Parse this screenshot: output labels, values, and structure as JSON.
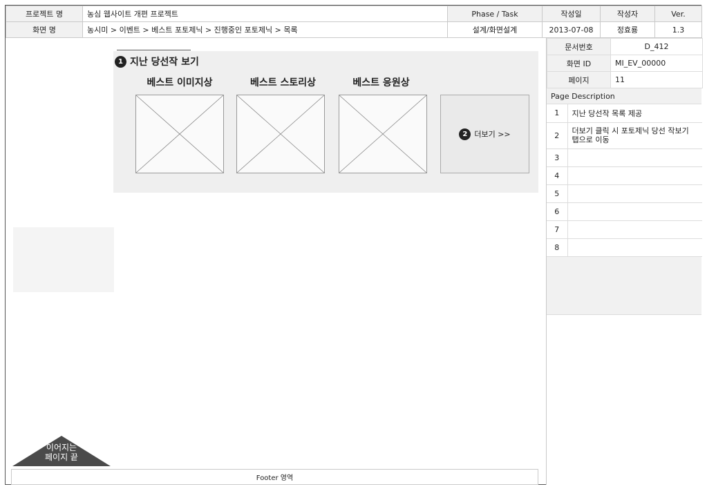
{
  "header": {
    "project_label": "프로젝트 명",
    "project_value": "농심 웹사이트 개편 프로젝트",
    "phase_label": "Phase / Task",
    "date_label": "작성일",
    "author_label": "작성자",
    "ver_label": "Ver.",
    "screen_label": "화면 명",
    "screen_value": "농시미 > 이벤트 > 베스트 포토제닉 > 진행중인 포토제닉 > 목록",
    "phase_value": "설계/화면설계",
    "date_value": "2013-07-08",
    "author_value": "정효룡",
    "ver_value": "1.3"
  },
  "meta": {
    "doc_no_label": "문서번호",
    "doc_no_value": "D_412",
    "screen_id_label": "화면 ID",
    "screen_id_value": "MI_EV_00000",
    "page_label": "페이지",
    "page_value": "11"
  },
  "page_description": {
    "title": "Page Description",
    "items": [
      {
        "num": "1",
        "text": "지난 당선작 목록 제공"
      },
      {
        "num": "2",
        "text": "더보기 클릭 시 포토제닉 당선 작보기 탭으로 이동"
      },
      {
        "num": "3",
        "text": ""
      },
      {
        "num": "4",
        "text": ""
      },
      {
        "num": "5",
        "text": ""
      },
      {
        "num": "6",
        "text": ""
      },
      {
        "num": "7",
        "text": ""
      },
      {
        "num": "8",
        "text": ""
      }
    ]
  },
  "section": {
    "badge": "1",
    "title": "지난 당선작 보기",
    "categories": [
      "베스트 이미지상",
      "베스트 스토리상",
      "베스트 응원상"
    ],
    "more_badge": "2",
    "more_label": "더보기 >>"
  },
  "continue_marker": {
    "line1": "이어지는",
    "line2": "페이지 끝"
  },
  "footer": {
    "label": "Footer 영역"
  }
}
